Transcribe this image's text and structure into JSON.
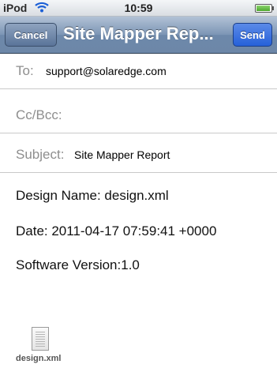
{
  "status_bar": {
    "carrier": "iPod",
    "wifi_icon": "wifi-icon",
    "time": "10:59",
    "battery_icon": "battery-icon",
    "battery_level": 0.9
  },
  "nav_bar": {
    "cancel_label": "Cancel",
    "title": "Site Mapper Rep...",
    "send_label": "Send",
    "send_color": "#2661d9"
  },
  "fields": {
    "to_label": "To:",
    "to_value": "support@solaredge.com",
    "cc_label": "Cc/Bcc:",
    "subject_label": "Subject:",
    "subject_value": "Site Mapper Report"
  },
  "body": {
    "line1": "Design Name: design.xml",
    "line2": "Date: 2011-04-17 07:59:41 +0000",
    "line3": "Software Version:1.0"
  },
  "attachment": {
    "icon": "document-icon",
    "name": "design.xml"
  }
}
